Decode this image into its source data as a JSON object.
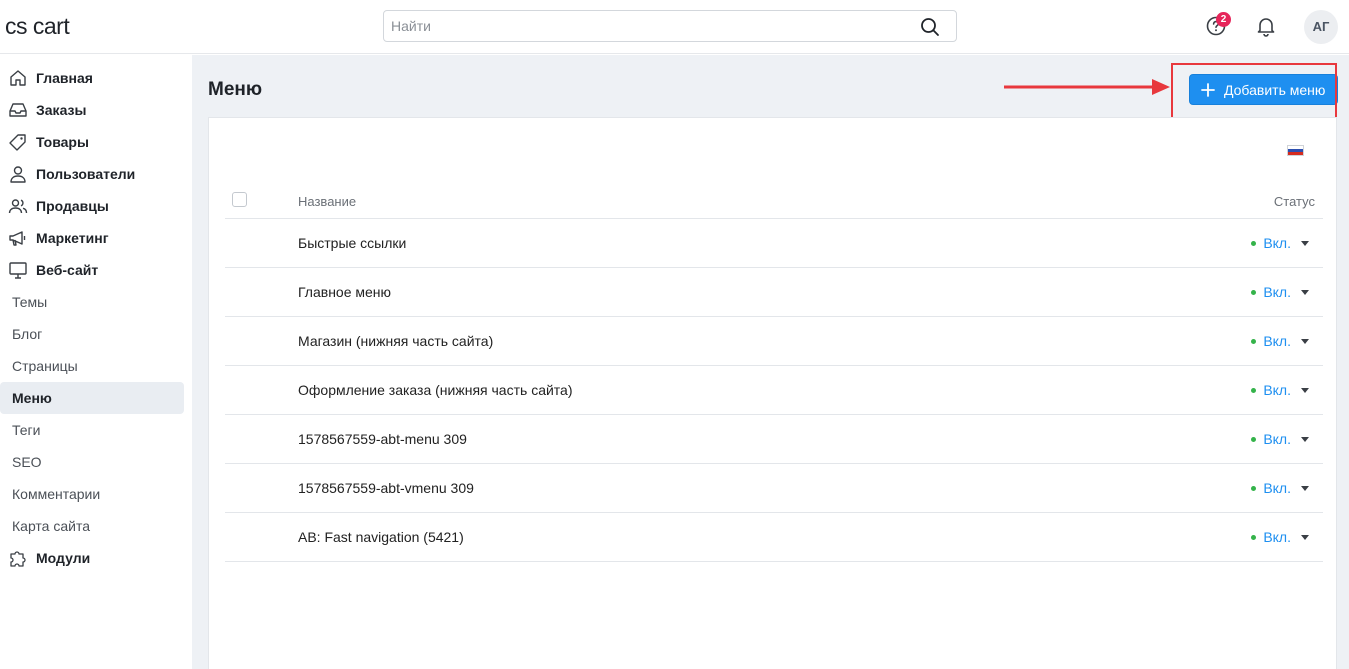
{
  "header": {
    "logo_cs": "cs",
    "logo_cart": "cart",
    "search_placeholder": "Найти",
    "help_badge": "2",
    "avatar_initials": "АГ"
  },
  "sidebar": {
    "items": [
      {
        "label": "Главная",
        "icon": "home-icon"
      },
      {
        "label": "Заказы",
        "icon": "inbox-icon"
      },
      {
        "label": "Товары",
        "icon": "tag-icon"
      },
      {
        "label": "Пользователи",
        "icon": "user-icon"
      },
      {
        "label": "Продавцы",
        "icon": "users-icon"
      },
      {
        "label": "Маркетинг",
        "icon": "megaphone-icon"
      },
      {
        "label": "Веб-сайт",
        "icon": "monitor-icon"
      }
    ],
    "website_sub": [
      "Темы",
      "Блог",
      "Страницы",
      "Меню",
      "Теги",
      "SEO",
      "Комментарии",
      "Карта сайта"
    ],
    "modules_label": "Модули"
  },
  "main": {
    "title": "Меню",
    "add_button_label": "Добавить меню",
    "table": {
      "col_name": "Название",
      "col_status": "Статус",
      "rows": [
        {
          "name": "Быстрые ссылки",
          "status": "Вкл."
        },
        {
          "name": "Главное меню",
          "status": "Вкл."
        },
        {
          "name": "Магазин (нижняя часть сайта)",
          "status": "Вкл."
        },
        {
          "name": "Оформление заказа (нижняя часть сайта)",
          "status": "Вкл."
        },
        {
          "name": "1578567559-abt-menu 309",
          "status": "Вкл."
        },
        {
          "name": "1578567559-abt-vmenu 309",
          "status": "Вкл."
        },
        {
          "name": "AB: Fast navigation (5421)",
          "status": "Вкл."
        }
      ]
    }
  },
  "colors": {
    "accent": "#1e8ff0",
    "status_on": "#34b34a",
    "highlight": "#e8383d",
    "badge": "#e6255a"
  }
}
